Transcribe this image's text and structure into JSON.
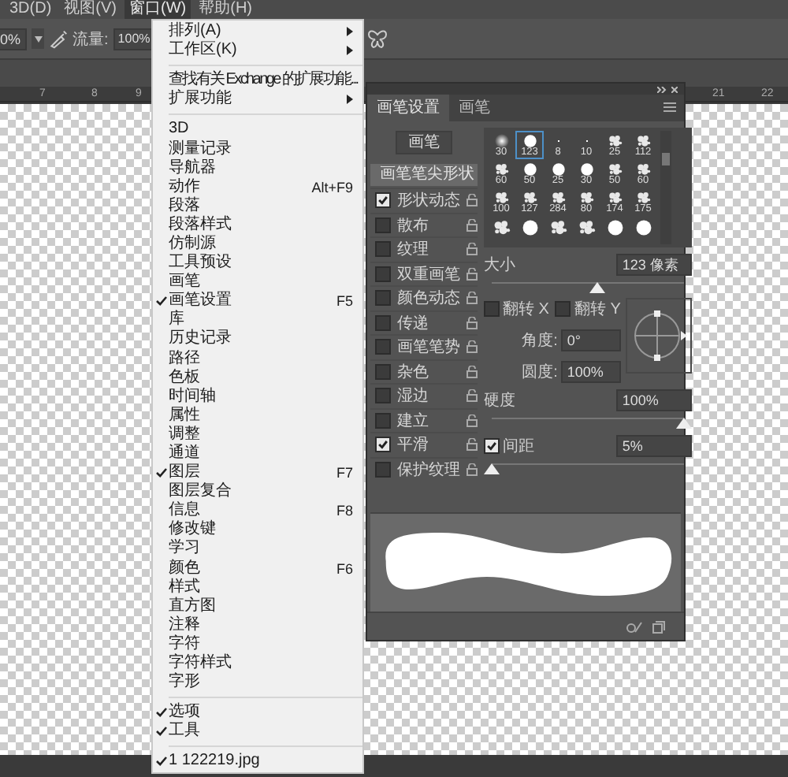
{
  "menu_bar": [
    {
      "label": "3D(D)",
      "selected": false
    },
    {
      "label": "视图(V)",
      "selected": false
    },
    {
      "label": "窗口(W)",
      "selected": true
    },
    {
      "label": "帮助(H)",
      "selected": false
    }
  ],
  "options_bar": {
    "zoom_value": "0%",
    "flow_label": "流量:",
    "flow_value": "100%"
  },
  "ruler": [
    "7",
    "8",
    "9",
    "21",
    "22"
  ],
  "window_menu": {
    "groups": [
      {
        "items": [
          {
            "label": "排列(A)",
            "kind": "submenu",
            "checked": false
          },
          {
            "label": "工作区(K)",
            "kind": "submenu",
            "checked": false
          }
        ]
      },
      {
        "items": [
          {
            "label": "查找有关 Exchange 的扩展功能...",
            "kind": "command",
            "checked": false
          },
          {
            "label": "扩展功能",
            "kind": "submenu",
            "checked": false
          }
        ]
      },
      {
        "items": [
          {
            "label": "3D",
            "kind": "command",
            "checked": false
          },
          {
            "label": "测量记录",
            "kind": "command",
            "checked": false
          },
          {
            "label": "导航器",
            "kind": "command",
            "checked": false
          },
          {
            "label": "动作",
            "kind": "command",
            "checked": false,
            "shortcut": "Alt+F9"
          },
          {
            "label": "段落",
            "kind": "command",
            "checked": false
          },
          {
            "label": "段落样式",
            "kind": "command",
            "checked": false
          },
          {
            "label": "仿制源",
            "kind": "command",
            "checked": false
          },
          {
            "label": "工具预设",
            "kind": "command",
            "checked": false
          },
          {
            "label": "画笔",
            "kind": "command",
            "checked": false
          },
          {
            "label": "画笔设置",
            "kind": "command",
            "checked": true,
            "shortcut": "F5"
          },
          {
            "label": "库",
            "kind": "command",
            "checked": false
          },
          {
            "label": "历史记录",
            "kind": "command",
            "checked": false
          },
          {
            "label": "路径",
            "kind": "command",
            "checked": false
          },
          {
            "label": "色板",
            "kind": "command",
            "checked": false
          },
          {
            "label": "时间轴",
            "kind": "command",
            "checked": false
          },
          {
            "label": "属性",
            "kind": "command",
            "checked": false
          },
          {
            "label": "调整",
            "kind": "command",
            "checked": false
          },
          {
            "label": "通道",
            "kind": "command",
            "checked": false
          },
          {
            "label": "图层",
            "kind": "command",
            "checked": true,
            "shortcut": "F7"
          },
          {
            "label": "图层复合",
            "kind": "command",
            "checked": false
          },
          {
            "label": "信息",
            "kind": "command",
            "checked": false,
            "shortcut": "F8"
          },
          {
            "label": "修改键",
            "kind": "command",
            "checked": false
          },
          {
            "label": "学习",
            "kind": "command",
            "checked": false
          },
          {
            "label": "颜色",
            "kind": "command",
            "checked": false,
            "shortcut": "F6"
          },
          {
            "label": "样式",
            "kind": "command",
            "checked": false
          },
          {
            "label": "直方图",
            "kind": "command",
            "checked": false
          },
          {
            "label": "注释",
            "kind": "command",
            "checked": false
          },
          {
            "label": "字符",
            "kind": "command",
            "checked": false
          },
          {
            "label": "字符样式",
            "kind": "command",
            "checked": false
          },
          {
            "label": "字形",
            "kind": "command",
            "checked": false
          }
        ]
      },
      {
        "items": [
          {
            "label": "选项",
            "kind": "command",
            "checked": true
          },
          {
            "label": "工具",
            "kind": "command",
            "checked": true
          }
        ]
      },
      {
        "items": [
          {
            "label": "1 122219.jpg",
            "kind": "command",
            "checked": true
          }
        ]
      }
    ]
  },
  "brush_panel": {
    "tabs": [
      {
        "label": "画笔设置",
        "selected": true
      },
      {
        "label": "画笔",
        "selected": false
      }
    ],
    "brushes_button": "画笔",
    "tip_shape": {
      "label": "画笔笔尖形状",
      "selected": true
    },
    "options": [
      {
        "label": "形状动态",
        "checked": true
      },
      {
        "label": "散布",
        "checked": false
      },
      {
        "label": "纹理",
        "checked": false
      },
      {
        "label": "双重画笔",
        "checked": false
      },
      {
        "label": "颜色动态",
        "checked": false
      },
      {
        "label": "传递",
        "checked": false
      },
      {
        "label": "画笔笔势",
        "checked": false
      },
      {
        "label": "杂色",
        "checked": false
      },
      {
        "label": "湿边",
        "checked": false
      },
      {
        "label": "建立",
        "checked": false
      },
      {
        "label": "平滑",
        "checked": true
      },
      {
        "label": "保护纹理",
        "checked": false
      }
    ],
    "presets": [
      {
        "kind": "soft",
        "size": "30",
        "selected": false
      },
      {
        "kind": "hard",
        "size": "123",
        "selected": true
      },
      {
        "kind": "dot",
        "size": "8",
        "selected": false
      },
      {
        "kind": "dot",
        "size": "10",
        "selected": false
      },
      {
        "kind": "texture",
        "size": "25",
        "selected": false
      },
      {
        "kind": "texture",
        "size": "112",
        "selected": false
      },
      {
        "kind": "texture",
        "size": "60",
        "selected": false
      },
      {
        "kind": "hard",
        "size": "50",
        "selected": false
      },
      {
        "kind": "hard",
        "size": "25",
        "selected": false
      },
      {
        "kind": "hard",
        "size": "30",
        "selected": false
      },
      {
        "kind": "texture",
        "size": "50",
        "selected": false
      },
      {
        "kind": "texture",
        "size": "60",
        "selected": false
      },
      {
        "kind": "texture",
        "size": "100",
        "selected": false
      },
      {
        "kind": "texture",
        "size": "127",
        "selected": false
      },
      {
        "kind": "texture",
        "size": "284",
        "selected": false
      },
      {
        "kind": "texture",
        "size": "80",
        "selected": false
      },
      {
        "kind": "texture",
        "size": "174",
        "selected": false
      },
      {
        "kind": "texture",
        "size": "175",
        "selected": false
      },
      {
        "kind": "texture",
        "selected": false
      },
      {
        "kind": "hard",
        "selected": false
      },
      {
        "kind": "texture",
        "selected": false
      },
      {
        "kind": "texture",
        "selected": false
      },
      {
        "kind": "hard",
        "selected": false
      },
      {
        "kind": "hard",
        "selected": false
      }
    ],
    "size": {
      "label": "大小",
      "value": "123 像素",
      "level": 0.55
    },
    "flip": [
      {
        "label": "翻转 X",
        "checked": false
      },
      {
        "label": "翻转 Y",
        "checked": false
      }
    ],
    "angle": {
      "label": "角度:",
      "value": "0°"
    },
    "roundness": {
      "label": "圆度:",
      "value": "100%"
    },
    "hardness": {
      "label": "硬度",
      "value": "100%",
      "level": 1
    },
    "spacing": {
      "label": "间距",
      "checked": true,
      "value": "5%",
      "level": 0
    }
  }
}
